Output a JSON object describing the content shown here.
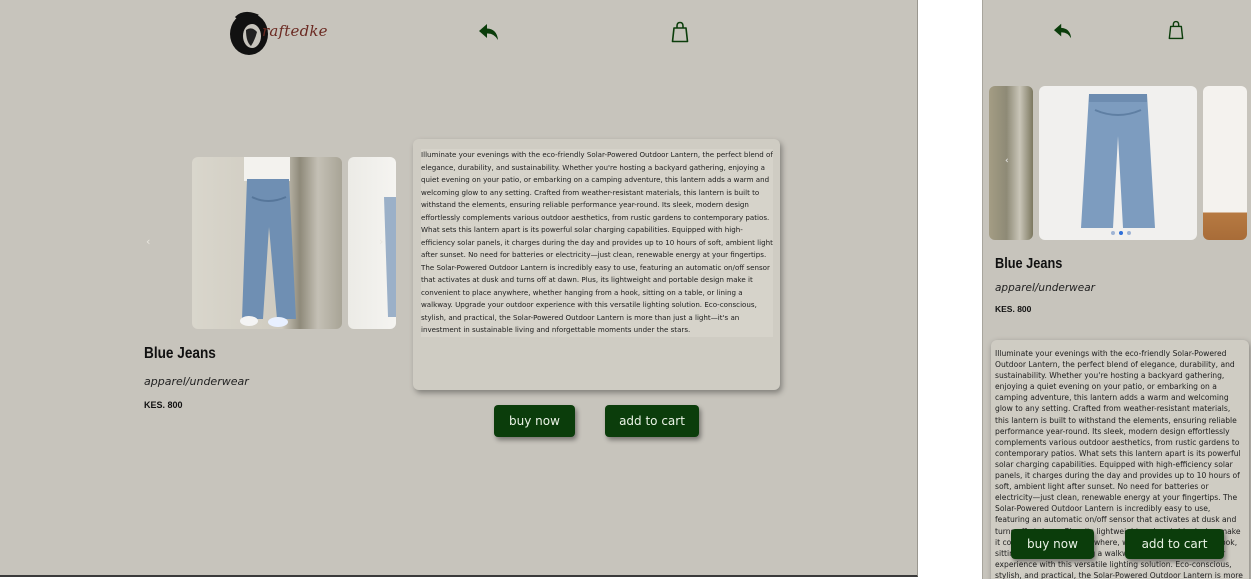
{
  "brand": {
    "logo_text": "raftedke"
  },
  "colors": {
    "background": "#c7c4bc",
    "button": "#0b3d0b",
    "icon": "#0b3d0b",
    "card": "#cfccc3"
  },
  "header": {
    "back_icon": "reply-arrow-icon",
    "cart_icon": "shopping-bag-icon"
  },
  "carousel": {
    "prev": "‹",
    "next": "›",
    "active_index": 1,
    "slide_count": 3
  },
  "product": {
    "title": "Blue Jeans",
    "category": "apparel/underwear",
    "price": "KES. 800",
    "description": "Illuminate your evenings with the eco-friendly Solar-Powered Outdoor Lantern, the perfect blend of elegance, durability, and sustainability. Whether you're hosting a backyard gathering, enjoying a quiet evening on your patio, or embarking on a camping adventure, this lantern adds a warm and welcoming glow to any setting. Crafted from weather-resistant materials, this lantern is built to withstand the elements, ensuring reliable performance year-round. Its sleek, modern design effortlessly complements various outdoor aesthetics, from rustic gardens to contemporary patios. What sets this lantern apart is its powerful solar charging capabilities. Equipped with high-efficiency solar panels, it charges during the day and provides up to 10 hours of soft, ambient light after sunset. No need for batteries or electricity—just clean, renewable energy at your fingertips. The Solar-Powered Outdoor Lantern is incredibly easy to use, featuring an automatic on/off sensor that activates at dusk and turns off at dawn. Plus, its lightweight and portable design make it convenient to place anywhere, whether hanging from a hook, sitting on a table, or lining a walkway. Upgrade your outdoor experience with this versatile lighting solution. Eco-conscious, stylish, and practical, the Solar-Powered Outdoor Lantern is more than just a light—it's an investment in sustainable living and nforgettable moments under the stars."
  },
  "actions": {
    "buy_now": "buy now",
    "add_to_cart": "add to cart"
  }
}
